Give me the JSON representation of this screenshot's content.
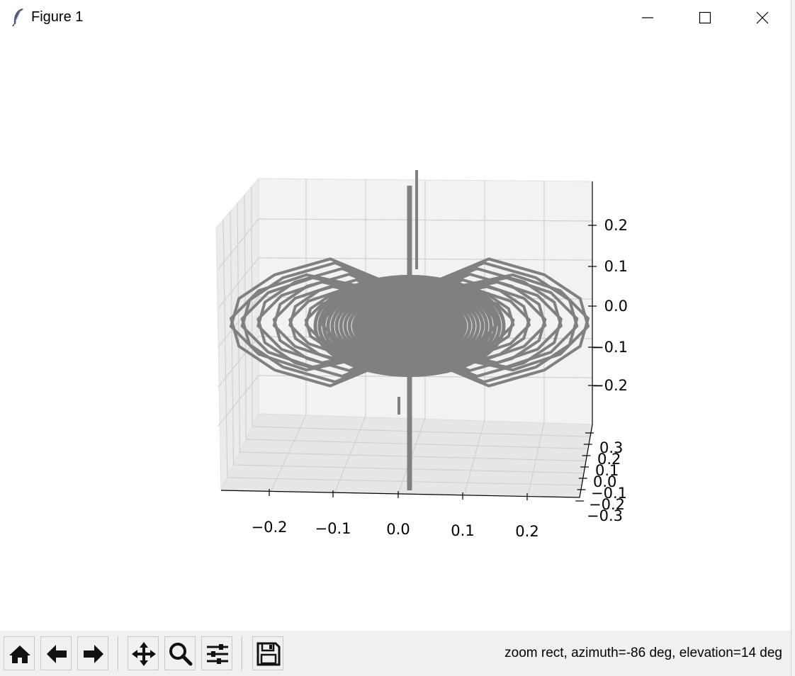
{
  "window": {
    "title": "Figure 1"
  },
  "controls": {
    "minimize": "minimize-icon",
    "maximize": "maximize-icon",
    "close": "close-icon"
  },
  "chart_data": {
    "type": "line",
    "projection": "3d",
    "line_color": "#808080",
    "x_ticks": [
      "−0.2",
      "−0.1",
      "0.0",
      "0.1",
      "0.2"
    ],
    "y_ticks": [
      "0.3",
      "0.2",
      "0.1",
      "0.0",
      "−0.1",
      "−0.2",
      "−0.3"
    ],
    "z_ticks": [
      "0.2",
      "0.1",
      "0.0",
      "−0.1",
      "−0.2"
    ],
    "xlim": [
      -0.25,
      0.25
    ],
    "ylim": [
      -0.3,
      0.3
    ],
    "zlim": [
      -0.25,
      0.25
    ],
    "grid": true,
    "pane_color": "#f2f2f2",
    "grid_color": "#d0d0d0"
  },
  "toolbar": {
    "buttons": [
      {
        "name": "home-button",
        "icon": "home-icon"
      },
      {
        "name": "back-button",
        "icon": "arrow-left-icon"
      },
      {
        "name": "forward-button",
        "icon": "arrow-right-icon"
      },
      {
        "name": "pan-button",
        "icon": "move-icon"
      },
      {
        "name": "zoom-button",
        "icon": "magnifier-icon"
      },
      {
        "name": "configure-subplots-button",
        "icon": "sliders-icon"
      },
      {
        "name": "save-button",
        "icon": "floppy-disk-icon"
      }
    ],
    "status": "zoom rect, azimuth=-86 deg, elevation=14 deg"
  }
}
